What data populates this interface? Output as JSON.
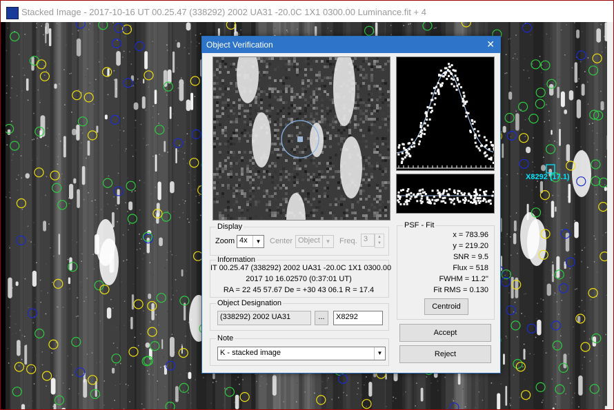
{
  "window": {
    "title": "Stacked Image - 2017-10-16 UT 00.25.47 (338292) 2002 UA31 -20.0C 1X1 0300.00 Luminance.fit + 4"
  },
  "image": {
    "target_label": "X8292 (17.1)"
  },
  "dialog": {
    "title": "Object Verification",
    "close": "✕",
    "display": {
      "group_label": "Display",
      "zoom_label": "Zoom",
      "zoom_value": "4x",
      "center_label": "Center",
      "center_value": "Object",
      "freq_label": "Freq.",
      "freq_value": "3"
    },
    "information": {
      "group_label": "Information",
      "line1": "IT 00.25.47 (338292) 2002 UA31 -20.0C 1X1 0300.00",
      "line2": "2017 10 16.02570 (0:37:01 UT)",
      "line3": "RA = 22 45 57.67   De = +30 43 06.1   R = 17.4"
    },
    "designation": {
      "group_label": "Object Designation",
      "name_value": "(338292) 2002 UA31",
      "browse": "...",
      "code_value": "X8292"
    },
    "note": {
      "group_label": "Note",
      "value": "K - stacked image"
    },
    "psf": {
      "group_label": "PSF - Fit",
      "x": "x = 783.96",
      "y": "y = 219.20",
      "snr": "SNR = 9.5",
      "flux": "Flux = 518",
      "fwhm": "FWHM = 11.2''",
      "fit_rms": "Fit RMS = 0.130",
      "centroid": "Centroid"
    },
    "accept": "Accept",
    "reject": "Reject"
  },
  "colors": {
    "dialog_title_bar": "#2e74c8",
    "circle_green": "#2ecc40",
    "circle_yellow": "#f0e010",
    "circle_blue": "#1a2ad0",
    "target_cyan": "#00e5ff"
  }
}
